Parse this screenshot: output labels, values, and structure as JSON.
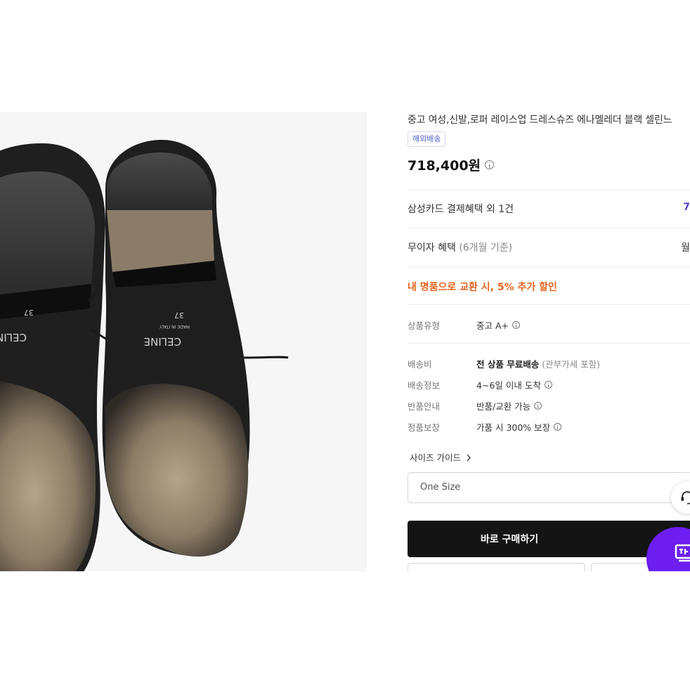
{
  "product": {
    "title": "중고 여성,신발,로퍼 레이스업 드레스슈즈 에나멜레더 블랙 셀린느",
    "badge": "해외배송",
    "price": "718,400원"
  },
  "benefits": {
    "card_label": "삼성카드 결제혜택 외 1건",
    "card_value": "7",
    "installment_label": "무이자 혜택",
    "installment_sub": "(6개월 기준)",
    "installment_value": "월",
    "promo": "내 명품으로 교환 시, 5% 추가 할인"
  },
  "specs": {
    "type_label": "상품유형",
    "type_value": "중고 A+",
    "shipping_fee_label": "배송비",
    "shipping_fee_value": "전 상품 무료배송",
    "shipping_fee_sub": "(관부가세 포함)",
    "shipping_info_label": "배송정보",
    "shipping_info_value": "4~6일 이내 도착",
    "return_label": "반품안내",
    "return_value": "반품/교환 가능",
    "authentic_label": "정품보장",
    "authentic_value": "가품 시 300% 보장"
  },
  "size": {
    "guide_label": "사이즈 가이드",
    "selected": "One Size"
  },
  "actions": {
    "buy_label": "바로 구매하기"
  },
  "photo": {
    "brand_text": "CELINE",
    "size_text": "37",
    "made_text": "MADE IN ITALY"
  },
  "colors": {
    "accent_purple": "#6c1ff0",
    "promo_orange": "#e2651f",
    "buy_button": "#141414",
    "badge_blue": "#4b5cc4"
  },
  "icons": {
    "chevron": "chevron-right-icon",
    "info": "info-circle-icon",
    "chat": "chat-support-icon",
    "purple_fab": "app-promo-icon"
  }
}
